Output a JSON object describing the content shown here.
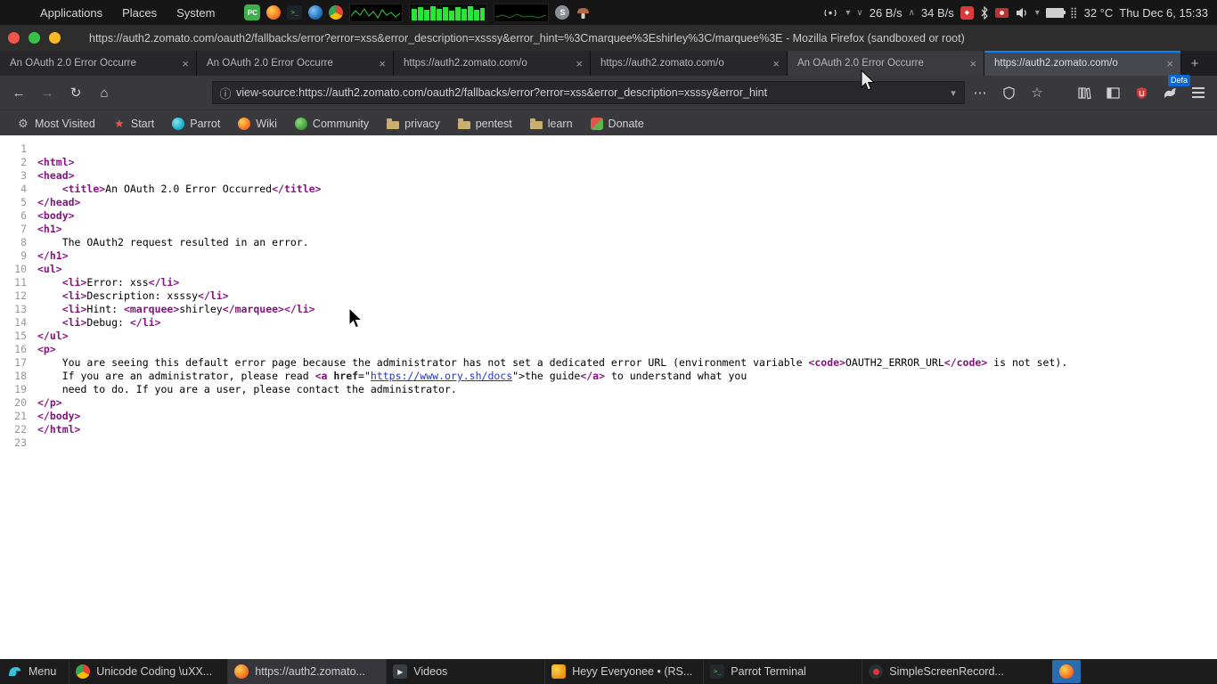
{
  "colors": {
    "accent_blue": "#0a84ff",
    "tag": "#881280",
    "link": "#2433cc",
    "content_bg": "#ffffff"
  },
  "glyphs": {
    "close": "×",
    "new_tab": "+",
    "back": "←",
    "forward": "→",
    "reload": "↻",
    "home": "⌂",
    "info": "ⓘ",
    "caret": "▾",
    "overflow": "⋯",
    "star_outline": "☆",
    "gear": "⚙",
    "star": "★",
    "terminal": ">_",
    "down": "∨",
    "up": "∧",
    "braille": "⣿",
    "diamond": "◆",
    "play": "▶"
  },
  "system_bar": {
    "menus": [
      "Applications",
      "Places",
      "System"
    ],
    "pc_label": "PC",
    "s_label": "S",
    "net_down": "26 B/s",
    "net_up": "34 B/s",
    "temperature": "32 °C",
    "clock": "Thu Dec 6, 15:33"
  },
  "window": {
    "title": "https://auth2.zomato.com/oauth2/fallbacks/error?error=xss&error_description=xsssy&error_hint=%3Cmarquee%3Eshirley%3C/marquee%3E - Mozilla Firefox (sandboxed or root)"
  },
  "tabs": [
    {
      "title": "An OAuth 2.0 Error Occurre",
      "state": "normal"
    },
    {
      "title": "An OAuth 2.0 Error Occurre",
      "state": "normal"
    },
    {
      "title": "https://auth2.zomato.com/o",
      "state": "normal"
    },
    {
      "title": "https://auth2.zomato.com/o",
      "state": "normal"
    },
    {
      "title": "An OAuth 2.0 Error Occurre",
      "state": "hover"
    },
    {
      "title": "https://auth2.zomato.com/o",
      "state": "active"
    }
  ],
  "navbar": {
    "url": "view-source:https://auth2.zomato.com/oauth2/fallbacks/error?error=xss&error_description=xsssy&error_hint",
    "profile_badge": "Defa"
  },
  "bookmarks": [
    {
      "label": "Most Visited",
      "icon": "gear"
    },
    {
      "label": "Start",
      "icon": "star"
    },
    {
      "label": "Parrot",
      "icon": "parrot"
    },
    {
      "label": "Wiki",
      "icon": "firefox"
    },
    {
      "label": "Community",
      "icon": "community"
    },
    {
      "label": "privacy",
      "icon": "folder"
    },
    {
      "label": "pentest",
      "icon": "folder"
    },
    {
      "label": "learn",
      "icon": "folder"
    },
    {
      "label": "Donate",
      "icon": "gift"
    }
  ],
  "source": {
    "lines": [
      [],
      [
        [
          "t",
          "<html>"
        ]
      ],
      [
        [
          "t",
          "<head>"
        ]
      ],
      [
        [
          "x",
          "    "
        ],
        [
          "t",
          "<title>"
        ],
        [
          "x",
          "An OAuth 2.0 Error Occurred"
        ],
        [
          "t",
          "</title>"
        ]
      ],
      [
        [
          "t",
          "</head>"
        ]
      ],
      [
        [
          "t",
          "<body>"
        ]
      ],
      [
        [
          "t",
          "<h1>"
        ]
      ],
      [
        [
          "x",
          "    The OAuth2 request resulted in an error."
        ]
      ],
      [
        [
          "t",
          "</h1>"
        ]
      ],
      [
        [
          "t",
          "<ul>"
        ]
      ],
      [
        [
          "x",
          "    "
        ],
        [
          "t",
          "<li>"
        ],
        [
          "x",
          "Error: xss"
        ],
        [
          "t",
          "</li>"
        ]
      ],
      [
        [
          "x",
          "    "
        ],
        [
          "t",
          "<li>"
        ],
        [
          "x",
          "Description: xsssy"
        ],
        [
          "t",
          "</li>"
        ]
      ],
      [
        [
          "x",
          "    "
        ],
        [
          "t",
          "<li>"
        ],
        [
          "x",
          "Hint: "
        ],
        [
          "t",
          "<marquee>"
        ],
        [
          "x",
          "shirley"
        ],
        [
          "t",
          "</marquee>"
        ],
        [
          "t",
          "</li>"
        ]
      ],
      [
        [
          "x",
          "    "
        ],
        [
          "t",
          "<li>"
        ],
        [
          "x",
          "Debug: "
        ],
        [
          "t",
          "</li>"
        ]
      ],
      [
        [
          "t",
          "</ul>"
        ]
      ],
      [
        [
          "t",
          "<p>"
        ]
      ],
      [
        [
          "x",
          "    You are seeing this default error page because the administrator has not set a dedicated error URL (environment variable "
        ],
        [
          "t",
          "<code>"
        ],
        [
          "x",
          "OAUTH2_ERROR_URL"
        ],
        [
          "t",
          "</code>"
        ],
        [
          "x",
          " is not set)."
        ]
      ],
      [
        [
          "x",
          "    If you are an administrator, please read "
        ],
        [
          "t",
          "<a "
        ],
        [
          "a",
          "href"
        ],
        [
          "x",
          "=\""
        ],
        [
          "l",
          "https://www.ory.sh/docs"
        ],
        [
          "x",
          "\">"
        ],
        [
          "x",
          "the guide"
        ],
        [
          "t",
          "</a>"
        ],
        [
          "x",
          " to understand what you"
        ]
      ],
      [
        [
          "x",
          "    need to do. If you are a user, please contact the administrator."
        ]
      ],
      [
        [
          "t",
          "</p>"
        ]
      ],
      [
        [
          "t",
          "</body>"
        ]
      ],
      [
        [
          "t",
          "</html>"
        ]
      ],
      []
    ]
  },
  "taskbar": {
    "menu_label": "Menu",
    "items": [
      {
        "label": "Unicode Coding \\uXX...",
        "icon": "chrome",
        "state": "normal"
      },
      {
        "label": "https://auth2.zomato...",
        "icon": "firefox",
        "state": "active"
      },
      {
        "label": "Videos",
        "icon": "videos",
        "state": "normal"
      },
      {
        "label": "Heyy Everyonee • (RS...",
        "icon": "rss",
        "state": "normal"
      },
      {
        "label": "Parrot Terminal",
        "icon": "terminal",
        "state": "normal"
      },
      {
        "label": "SimpleScreenRecord...",
        "icon": "recorder",
        "state": "normal"
      }
    ]
  }
}
